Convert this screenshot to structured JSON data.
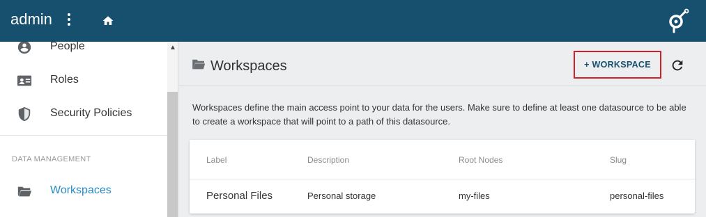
{
  "topbar": {
    "title": "admin",
    "menu_icon": "kebab-menu-icon",
    "home_icon": "home-icon",
    "logo_icon": "pydio-logo-icon",
    "background": "#17506f"
  },
  "sidebar": {
    "items": [
      {
        "label": "People",
        "icon": "person-icon"
      },
      {
        "label": "Roles",
        "icon": "id-card-icon"
      },
      {
        "label": "Security Policies",
        "icon": "shield-icon"
      }
    ],
    "section_title": "DATA MANAGEMENT",
    "section_items": [
      {
        "label": "Workspaces",
        "icon": "folder-open-icon",
        "active": true
      }
    ],
    "active_color": "#2a8bc4"
  },
  "main": {
    "title": "Workspaces",
    "title_icon": "folder-open-icon",
    "add_button": "+ WORKSPACE",
    "refresh_icon": "refresh-icon",
    "intro": "Workspaces define the main access point to your data for the users. Make sure to define at least one datasource to be able to create a workspace that will point to a path of this datasource.",
    "table": {
      "columns": [
        "Label",
        "Description",
        "Root Nodes",
        "Slug"
      ],
      "rows": [
        {
          "label": "Personal Files",
          "description": "Personal storage",
          "root_nodes": "my-files",
          "slug": "personal-files"
        }
      ]
    },
    "highlight_color": "#d0202a"
  }
}
